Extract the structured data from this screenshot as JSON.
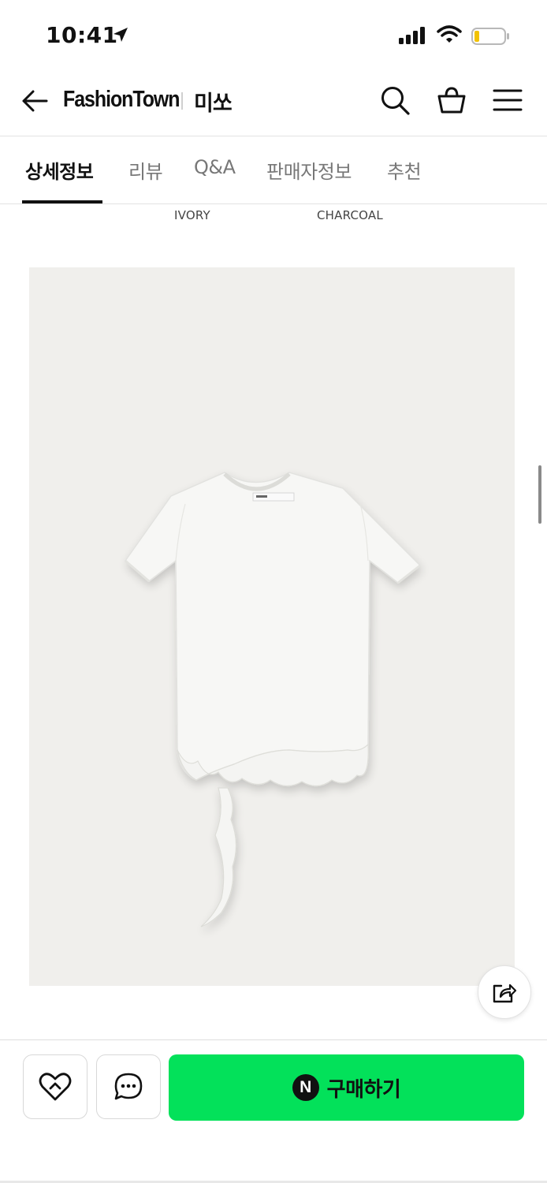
{
  "status_bar": {
    "time": "10:41"
  },
  "header": {
    "brand": "FashionTown",
    "shop_name": "미쏘"
  },
  "tabs": [
    {
      "label": "상세정보",
      "active": true
    },
    {
      "label": "리뷰",
      "active": false
    },
    {
      "label": "Q&A",
      "active": false
    },
    {
      "label": "판매자정보",
      "active": false
    },
    {
      "label": "추천",
      "active": false
    }
  ],
  "color_labels": [
    "IVORY",
    "CHARCOAL"
  ],
  "product": {
    "image": "white-asymmetric-ruffle-tshirt",
    "colors": {
      "background": "#f0efec",
      "shirt": "#f7f7f5"
    }
  },
  "bottom_bar": {
    "buy_label": "구매하기",
    "naver_badge": "N",
    "accent": "#03e15a"
  },
  "icons": [
    "location-arrow-icon",
    "signal-icon",
    "wifi-icon",
    "battery-icon",
    "back-arrow-icon",
    "search-icon",
    "cart-icon",
    "menu-icon",
    "share-icon",
    "heart-icon",
    "chat-icon"
  ]
}
